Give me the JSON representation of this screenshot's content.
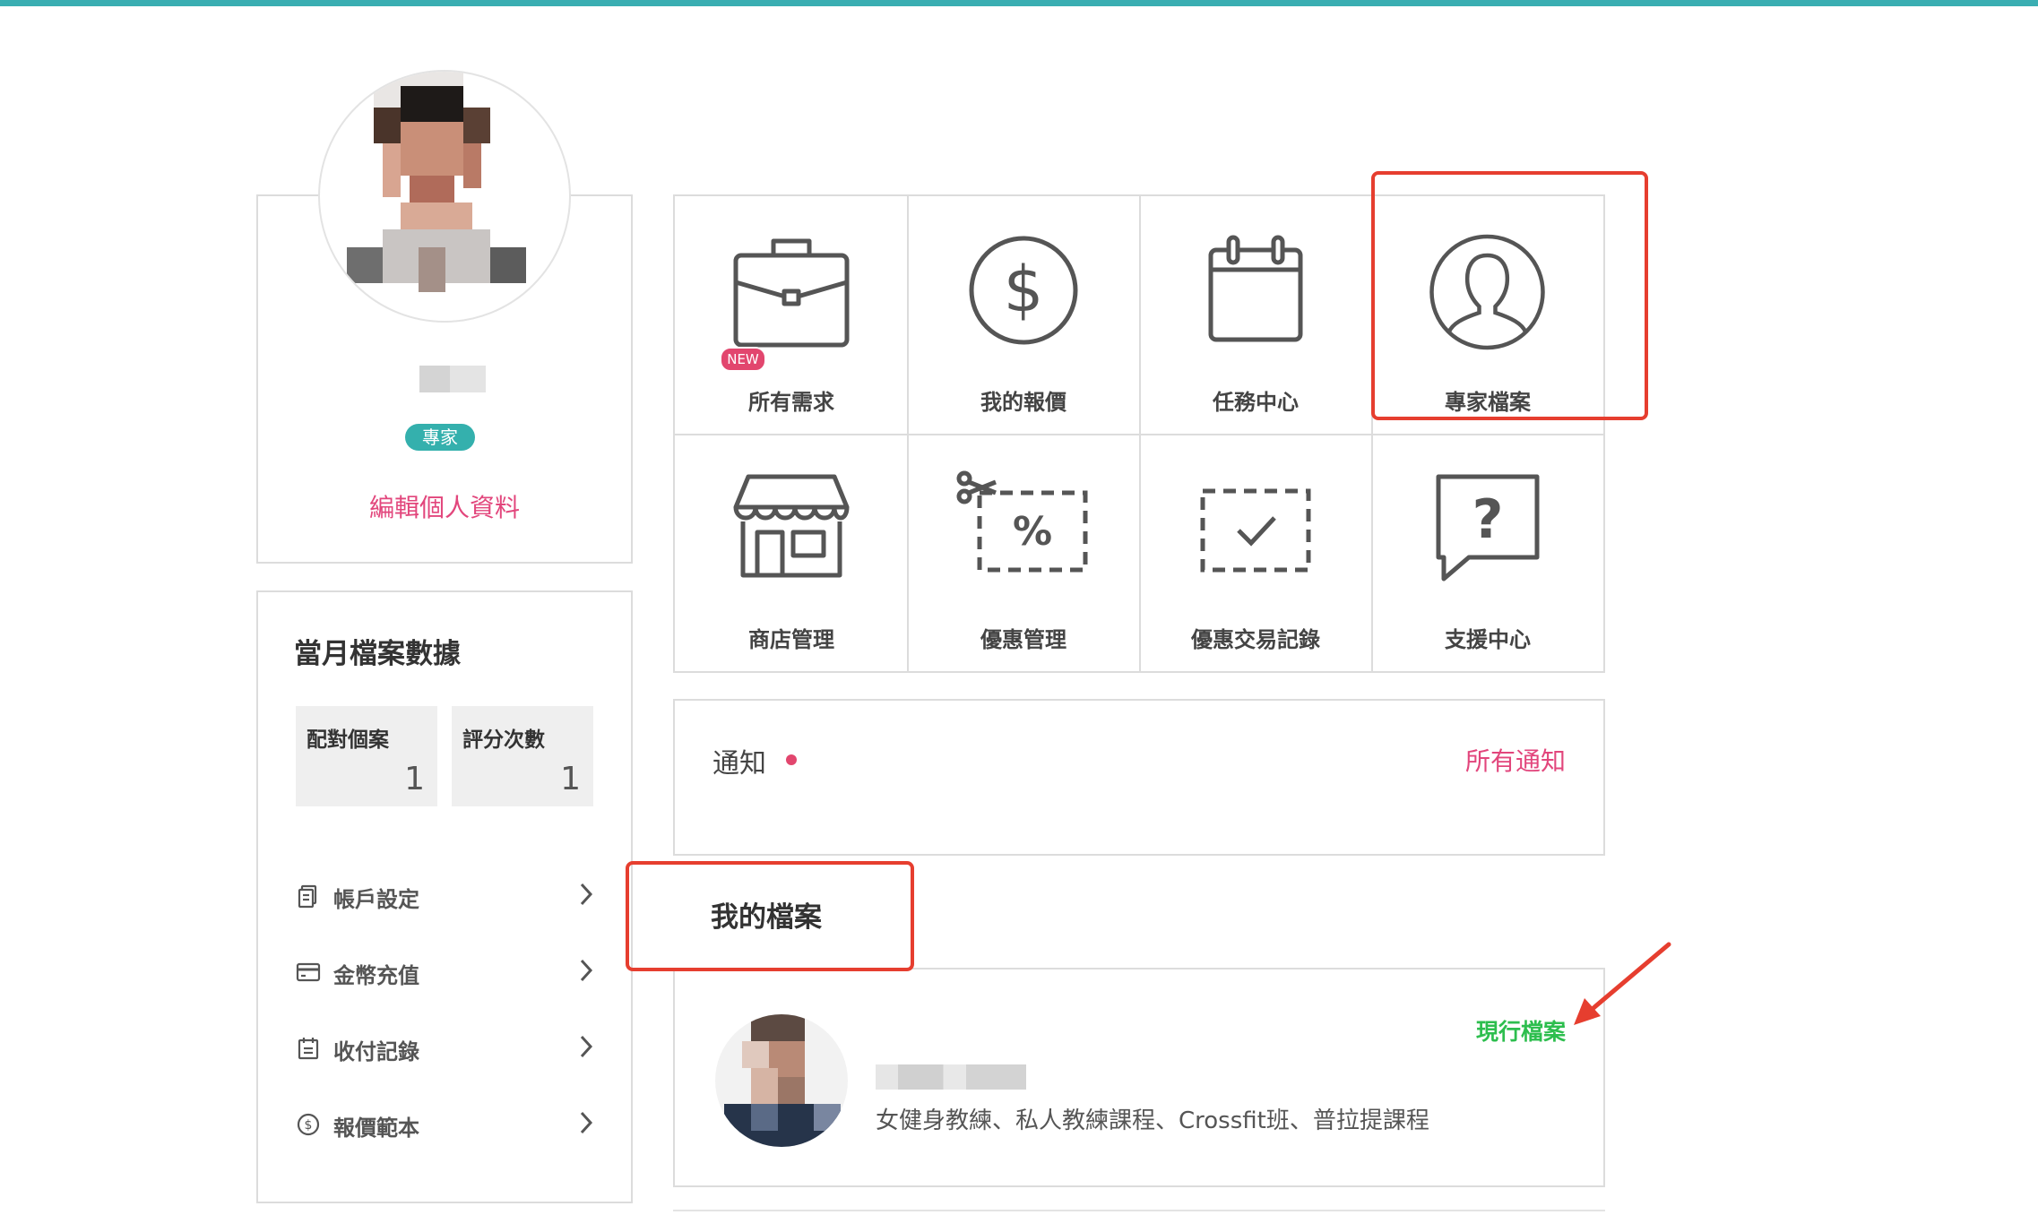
{
  "profile": {
    "role_badge": "專家",
    "edit_link": "編輯個人資料"
  },
  "stats": {
    "title": "當月檔案數據",
    "items": [
      {
        "label": "配對個案",
        "value": "1"
      },
      {
        "label": "評分次數",
        "value": "1"
      }
    ]
  },
  "menu": [
    {
      "label": "帳戶設定",
      "icon": "document-icon"
    },
    {
      "label": "金幣充值",
      "icon": "credit-card-icon"
    },
    {
      "label": "收付記錄",
      "icon": "calendar-record-icon"
    },
    {
      "label": "報價範本",
      "icon": "dollar-circle-icon"
    }
  ],
  "tiles": [
    {
      "label": "所有需求",
      "icon": "briefcase-icon",
      "badge": "NEW"
    },
    {
      "label": "我的報價",
      "icon": "dollar-icon"
    },
    {
      "label": "任務中心",
      "icon": "calendar-icon"
    },
    {
      "label": "專家檔案",
      "icon": "person-icon"
    },
    {
      "label": "商店管理",
      "icon": "store-icon"
    },
    {
      "label": "優惠管理",
      "icon": "coupon-icon",
      "coupon_symbol": "%"
    },
    {
      "label": "優惠交易記錄",
      "icon": "checked-ticket-icon"
    },
    {
      "label": "支援中心",
      "icon": "question-icon",
      "question_symbol": "?"
    }
  ],
  "notifications": {
    "title": "通知",
    "all_link": "所有通知"
  },
  "my_files": {
    "title": "我的檔案",
    "item": {
      "status": "現行檔案",
      "tags": "女健身教練、私人教練課程、Crossfit班、普拉提課程"
    }
  },
  "colors": {
    "accent_teal": "#3aaeb2",
    "link_pink": "#e2467c",
    "status_green": "#2dbe4e",
    "annotation_red": "#e63e2f"
  }
}
